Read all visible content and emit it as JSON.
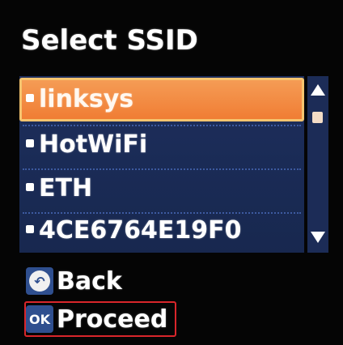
{
  "screen": {
    "title": "Select SSID"
  },
  "ssid_list": {
    "items": [
      {
        "label": "linksys",
        "selected": true
      },
      {
        "label": "HotWiFi",
        "selected": false
      },
      {
        "label": "ETH",
        "selected": false
      },
      {
        "label": "4CE6764E19F0",
        "selected": false
      }
    ]
  },
  "scrollbar": {
    "up_icon": "triangle-up",
    "down_icon": "triangle-down"
  },
  "softkeys": {
    "back_key_glyph": "↶",
    "back_label": "Back",
    "ok_key_glyph": "OK",
    "proceed_label": "Proceed"
  },
  "colors": {
    "list_bg": "#1f2f5c",
    "selected_bg": "#f28a40",
    "selected_border": "#f5c46f",
    "proceed_highlight": "#d9262b",
    "key_bg": "#2f4f8f"
  }
}
